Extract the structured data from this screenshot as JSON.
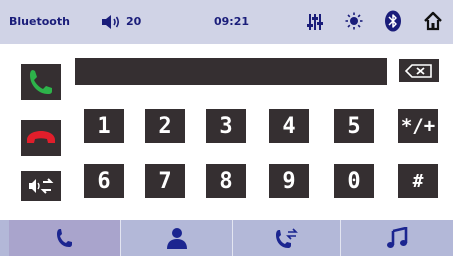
{
  "status": {
    "source_label": "Bluetooth",
    "volume": "20",
    "time": "09:21",
    "icons": [
      "speaker-icon",
      "equalizer-icon",
      "brightness-icon",
      "bluetooth-icon",
      "home-icon"
    ]
  },
  "dialer": {
    "display_value": "",
    "row1": [
      "1",
      "2",
      "3",
      "4",
      "5",
      "*/+"
    ],
    "row2": [
      "6",
      "7",
      "8",
      "9",
      "0",
      "#"
    ]
  },
  "colors": {
    "status_bar": "#d0d3e6",
    "button_dark": "#352f31",
    "call_green": "#2db34a",
    "hangup_red": "#e11e2b",
    "bottom_bar": "#b3b8d8",
    "tab_active": "#a9a4cc",
    "nav_icon": "#1b2590"
  },
  "bottom_tabs": [
    {
      "icon": "phone-icon",
      "active": true
    },
    {
      "icon": "contacts-icon",
      "active": false
    },
    {
      "icon": "call-transfer-icon",
      "active": false
    },
    {
      "icon": "music-icon",
      "active": false
    }
  ]
}
